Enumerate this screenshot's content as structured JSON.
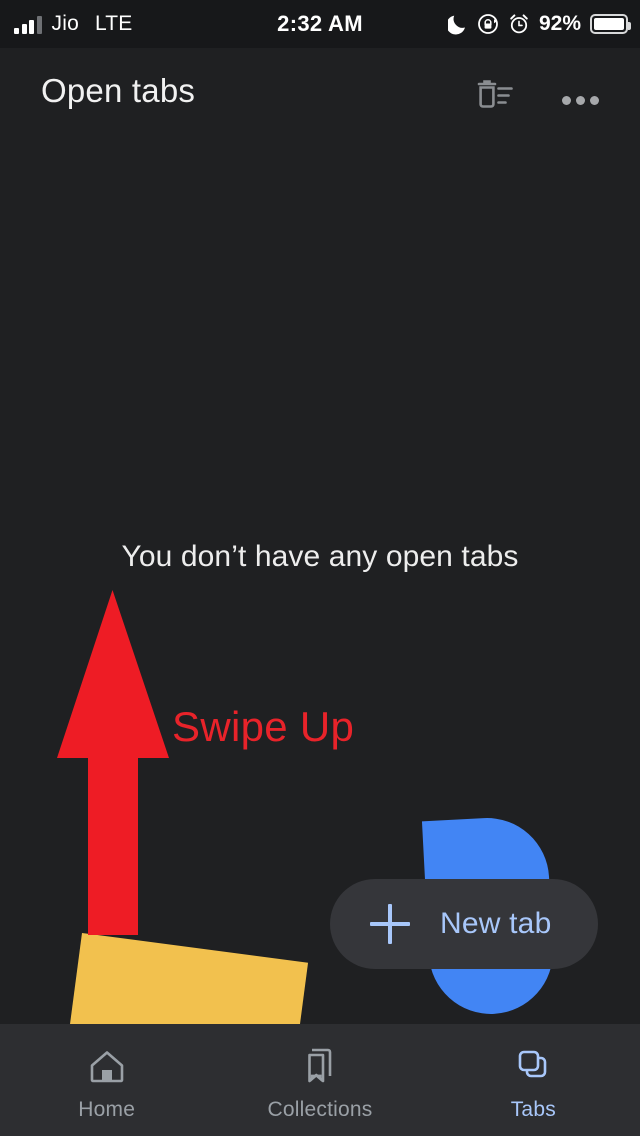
{
  "status_bar": {
    "carrier": "Jio",
    "network": "LTE",
    "time": "2:32 AM",
    "battery_percent": "92%",
    "icons": [
      "signal-bars-icon",
      "do-not-disturb-moon-icon",
      "rotation-lock-icon",
      "alarm-clock-icon",
      "battery-icon"
    ]
  },
  "header": {
    "title": "Open tabs",
    "close_all_tabs_icon": "trash-list-icon",
    "overflow_menu_icon": "more-horizontal-icon"
  },
  "main": {
    "empty_state_text": "You don’t have any open tabs",
    "annotation_text": "Swipe Up",
    "annotation_color": "#e8232a",
    "new_tab_label": "New tab",
    "new_tab_plus_icon": "plus-icon",
    "decoration_blue_color": "#4285f4",
    "decoration_yellow_color": "#f2c14e"
  },
  "bottom_nav": {
    "items": [
      {
        "label": "Home",
        "icon": "home-icon",
        "active": false
      },
      {
        "label": "Collections",
        "icon": "collections-bookmark-icon",
        "active": false
      },
      {
        "label": "Tabs",
        "icon": "tabs-icon",
        "active": true
      }
    ],
    "active_color": "#a8c7fa",
    "inactive_color": "#9aa0a6"
  }
}
